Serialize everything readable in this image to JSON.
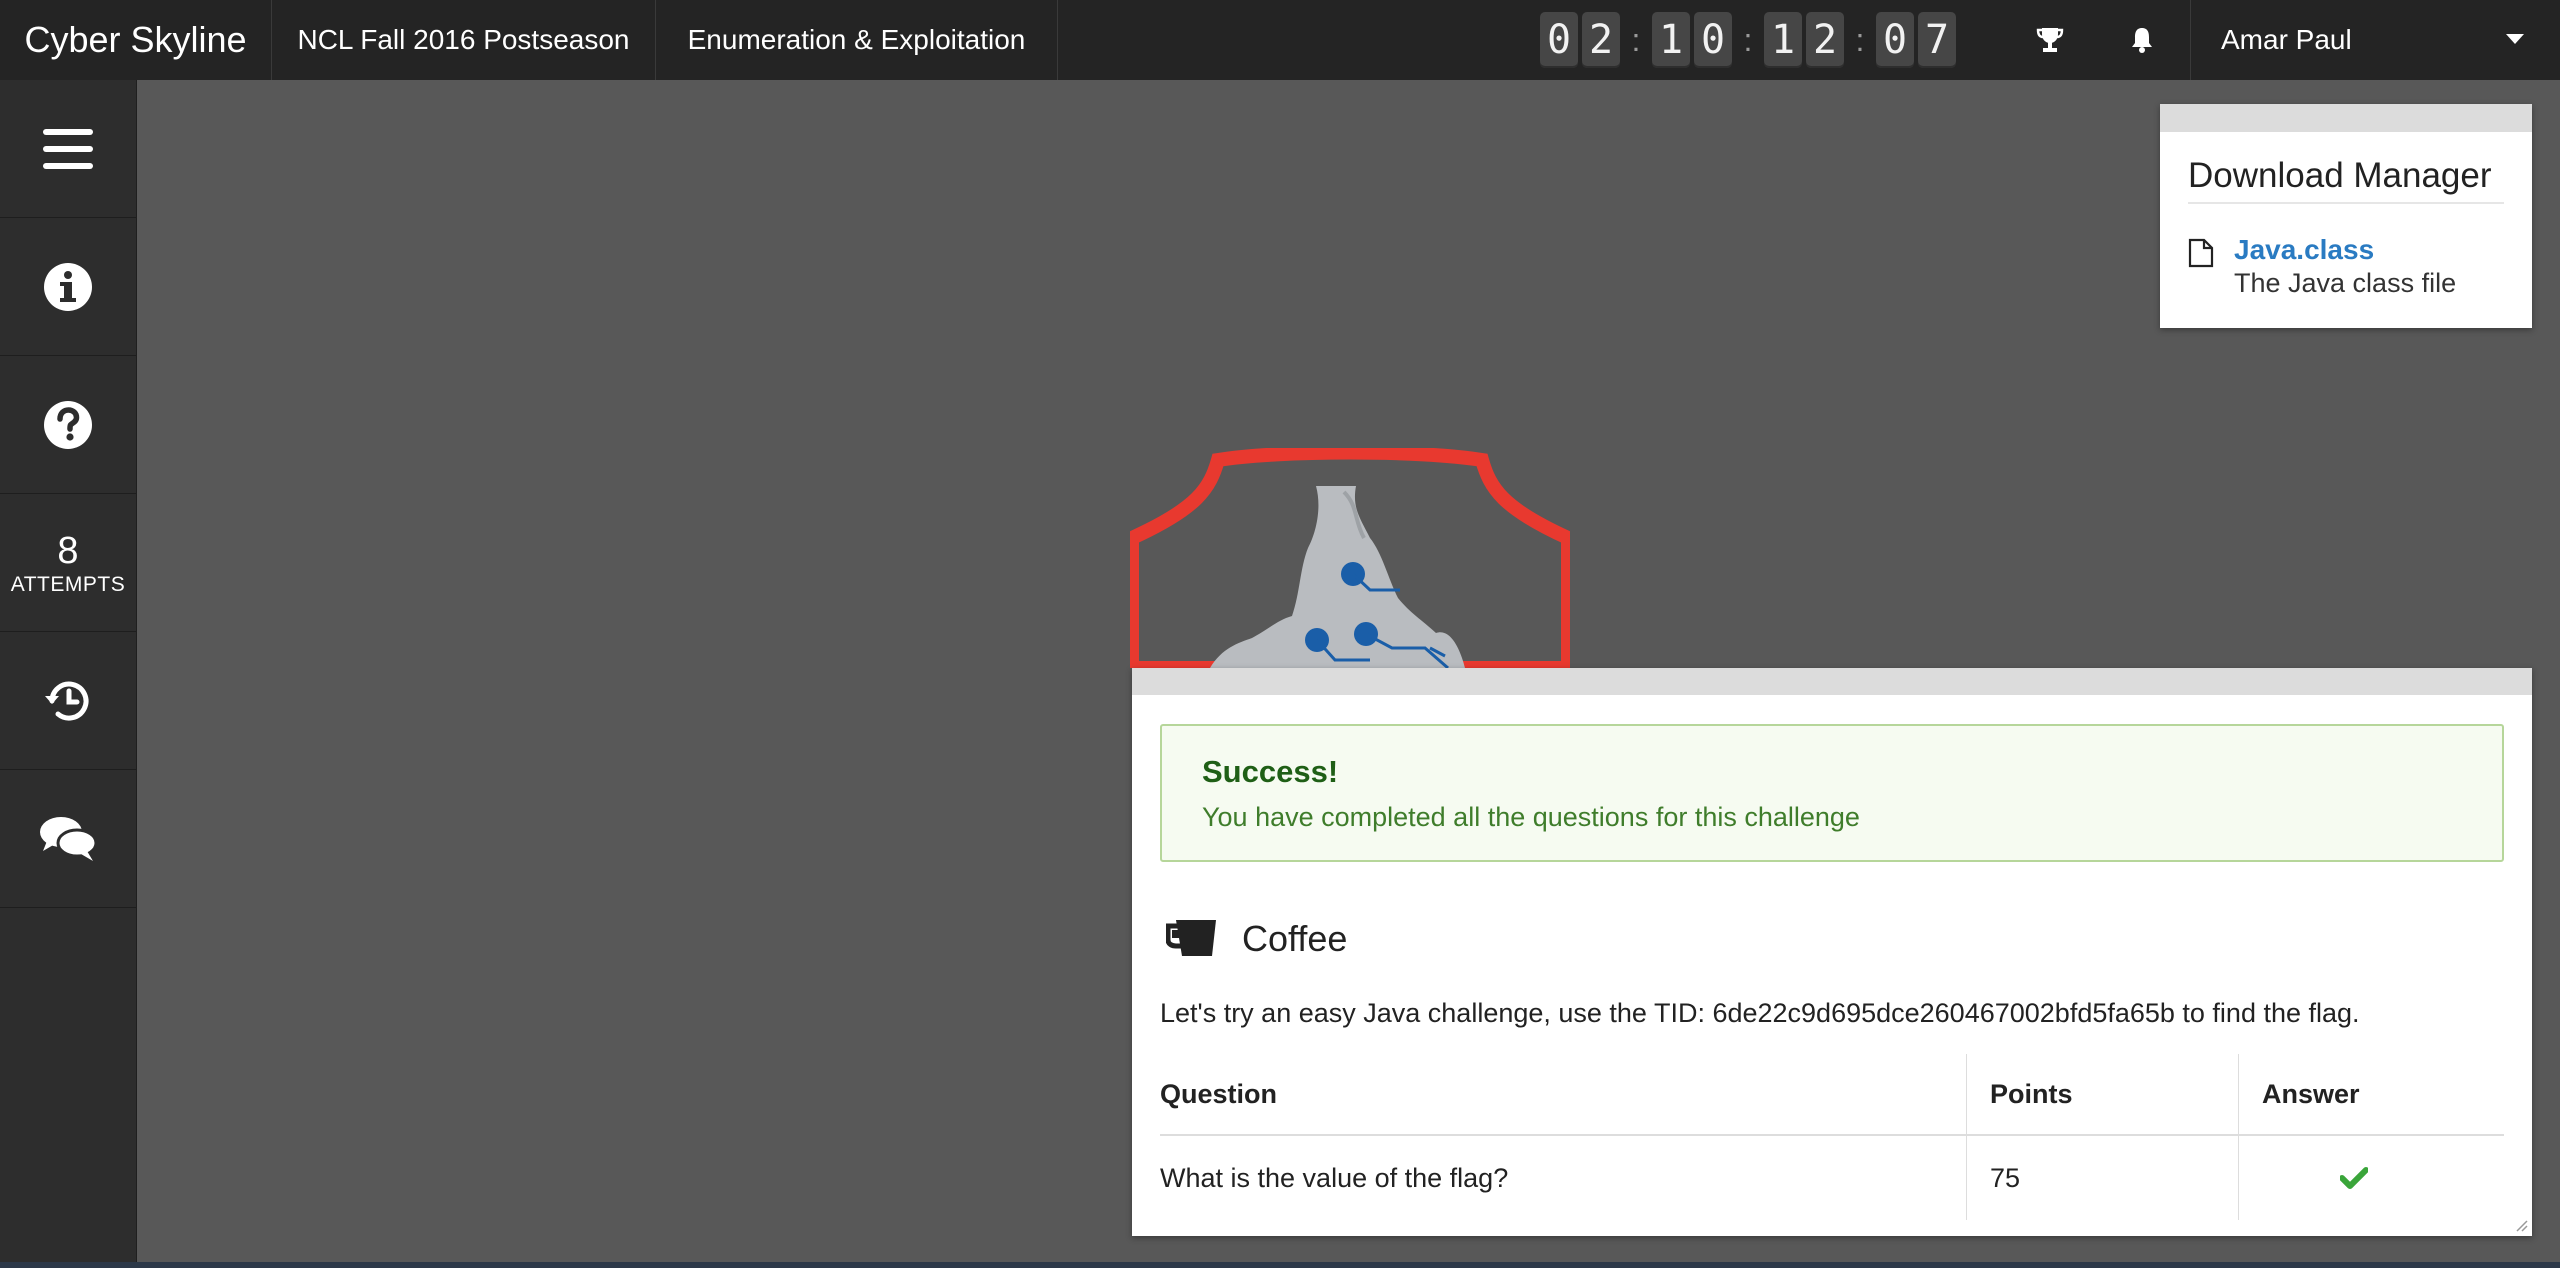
{
  "app": {
    "brand": "Cyber Skyline"
  },
  "breadcrumbs": [
    "NCL Fall 2016 Postseason",
    "Enumeration & Exploitation"
  ],
  "timer": {
    "digits": [
      "0",
      "2",
      "1",
      "0",
      "1",
      "2",
      "0",
      "7"
    ]
  },
  "header": {
    "user_name": "Amar Paul",
    "trophy_icon": "trophy-icon",
    "bell_icon": "bell-icon"
  },
  "sidebar": {
    "attempts_count": "8",
    "attempts_label": "ATTEMPTS",
    "icons": [
      "menu-icon",
      "info-icon",
      "help-icon",
      "history-icon",
      "chat-icon"
    ]
  },
  "download_manager": {
    "title": "Download Manager",
    "files": [
      {
        "name": "Java.class",
        "description": "The Java class file"
      }
    ]
  },
  "challenge": {
    "alert_title": "Success!",
    "alert_message": "You have completed all the questions for this challenge",
    "title": "Coffee",
    "description": "Let's try an easy Java challenge, use the TID: 6de22c9d695dce260467002bfd5fa65b to find the flag.",
    "table": {
      "headers": [
        "Question",
        "Points",
        "Answer"
      ],
      "rows": [
        {
          "question": "What is the value of the flag?",
          "points": "75",
          "answer": "check"
        }
      ]
    }
  },
  "colors": {
    "topbar": "#242424",
    "sidebar": "#2d2d2d",
    "background": "#585858",
    "link": "#2a7bc2",
    "success": "#3f7d2b",
    "shield": "#e8392f",
    "circuit": "#1a5ea8"
  }
}
